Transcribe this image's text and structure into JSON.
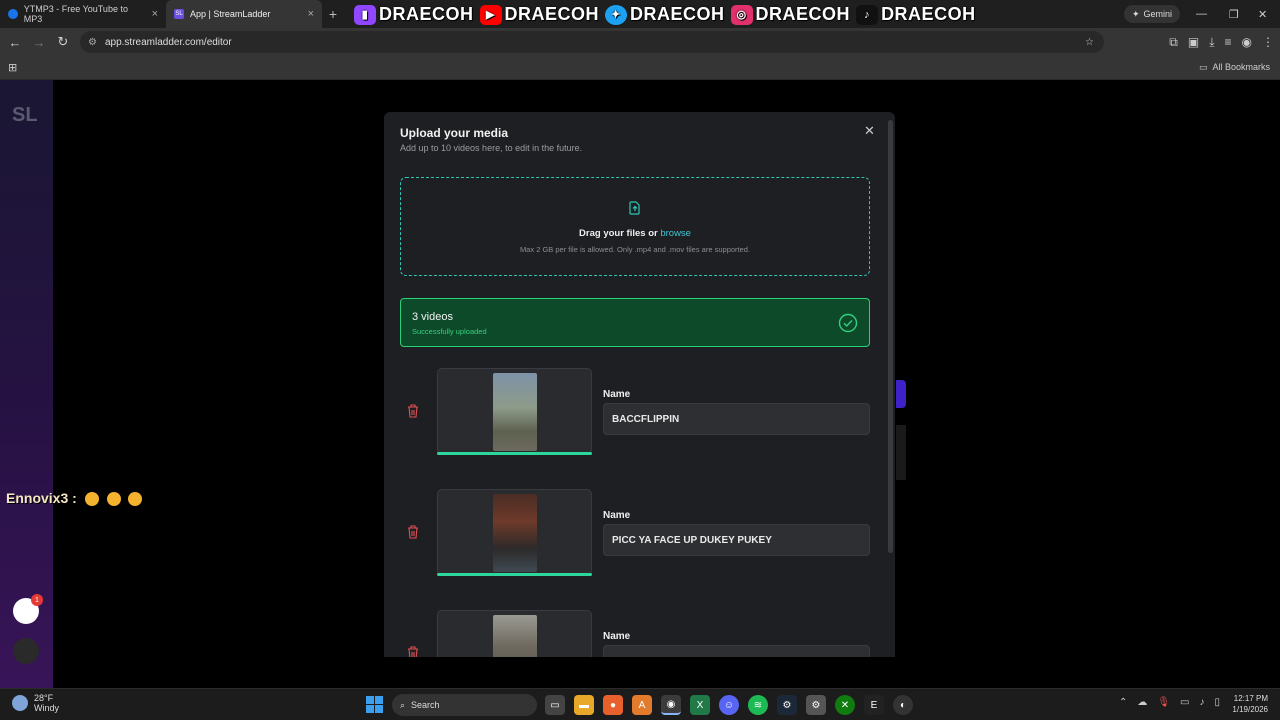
{
  "browser": {
    "tabs": [
      {
        "title": "YTMP3 - Free YouTube to MP3"
      },
      {
        "title": "App | StreamLadder"
      }
    ],
    "url": "app.streamladder.com/editor",
    "gemini_label": "Gemini",
    "bookmarks_label": "All Bookmarks"
  },
  "overlay": {
    "socials": [
      {
        "platform": "twitch-icon",
        "handle": "DRAECOH",
        "color": "#9146ff"
      },
      {
        "platform": "youtube-icon",
        "handle": "DRAECOH",
        "color": "#ff0000"
      },
      {
        "platform": "twitter-icon",
        "handle": "DRAECOH",
        "color": "#1da1f2"
      },
      {
        "platform": "instagram-icon",
        "handle": "DRAECOH",
        "color": "#e1306c"
      },
      {
        "platform": "tiktok-icon",
        "handle": "DRAECOH",
        "color": "#111111"
      }
    ],
    "chat_message": "Ennovix3 :"
  },
  "app": {
    "logo": "SL"
  },
  "modal": {
    "title": "Upload your media",
    "subtitle": "Add up to 10 videos here, to edit in the future.",
    "dropzone": {
      "prefix": "Drag your files or",
      "link": "browse",
      "note": "Max 2 GB per file is allowed. Only .mp4 and .mov files are supported."
    },
    "status": {
      "title": "3 videos",
      "subtitle": "Successfully uploaded"
    },
    "name_label": "Name",
    "videos": [
      {
        "name": "BACCFLIPPIN",
        "progress": 1.0
      },
      {
        "name": "PICC YA FACE UP DUKEY PUKEY",
        "progress": 1.0
      },
      {
        "name": "",
        "progress": 1.0
      }
    ]
  },
  "taskbar": {
    "weather_temp": "28°F",
    "weather_desc": "Windy",
    "search_label": "Search",
    "time": "12:17 PM",
    "date": "1/19/2026"
  }
}
